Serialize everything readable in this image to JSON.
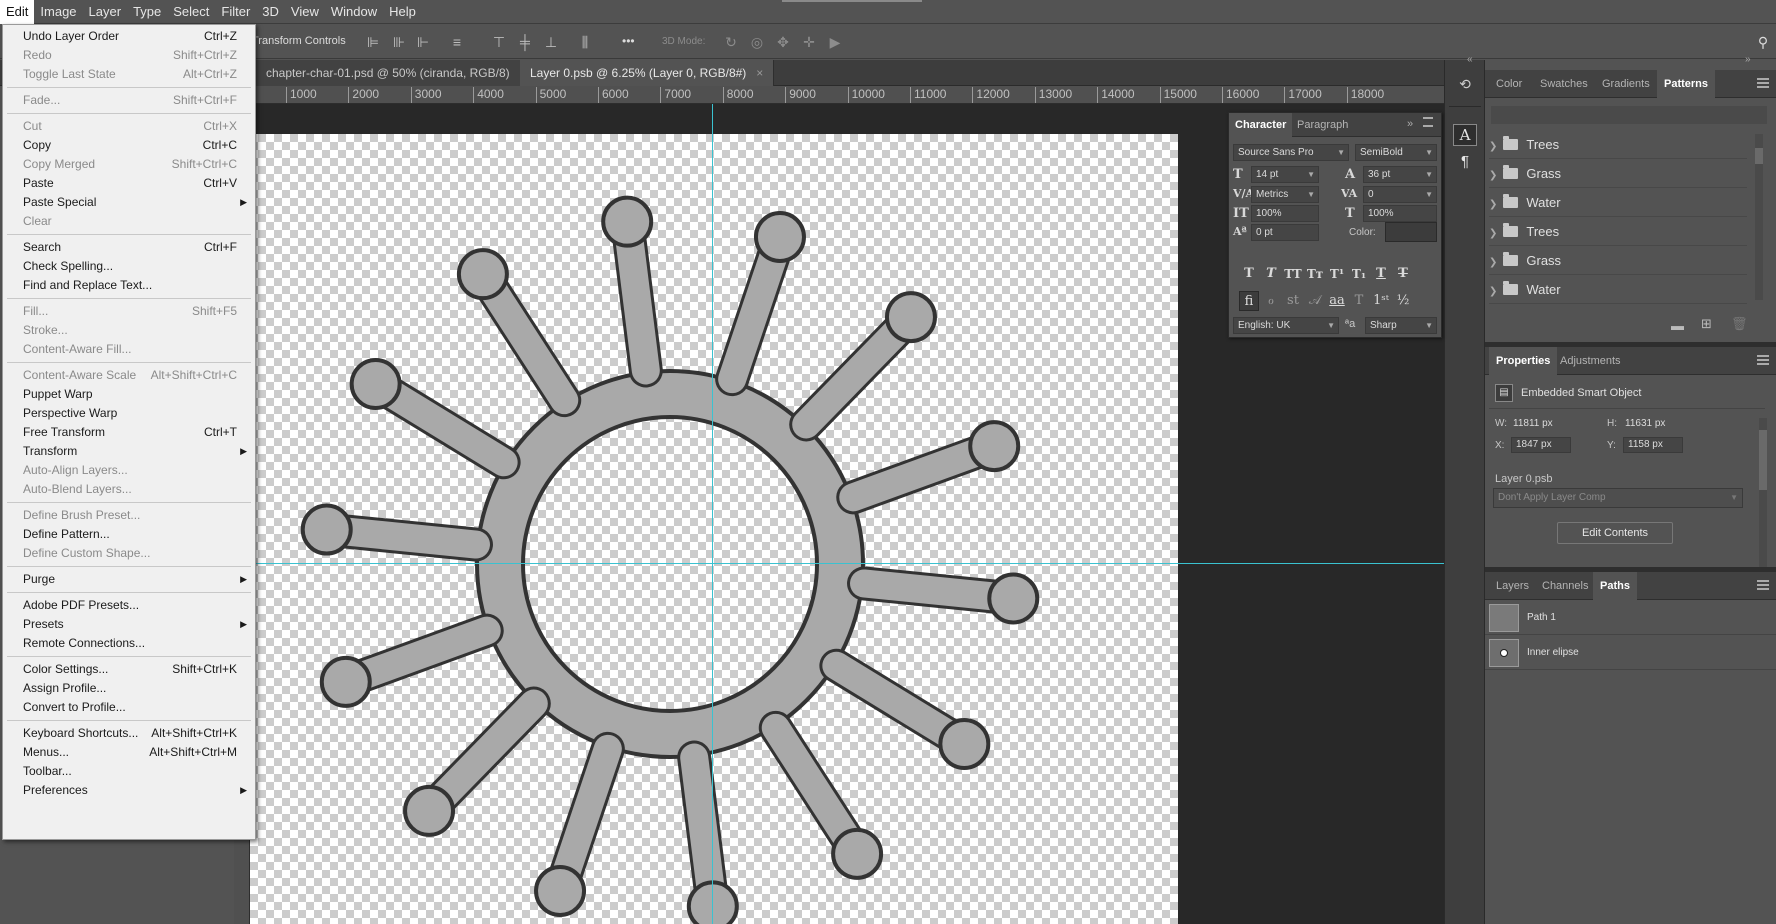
{
  "menubar": {
    "items": [
      "Edit",
      "Image",
      "Layer",
      "Type",
      "Select",
      "Filter",
      "3D",
      "View",
      "Window",
      "Help"
    ]
  },
  "optionsbar": {
    "transform_controls": "Transform Controls",
    "mode_3d": "3D Mode:",
    "more": "•••"
  },
  "tabs": [
    {
      "label": "chapter-char-01.psd @ 50% (ciranda, RGB/8)"
    },
    {
      "label": "Layer 0.psb @ 6.25% (Layer 0, RGB/8#)"
    }
  ],
  "ruler": {
    "labels": [
      "1000",
      "2000",
      "3000",
      "4000",
      "5000",
      "6000",
      "7000",
      "8000",
      "9000",
      "10000",
      "11000",
      "12000",
      "13000",
      "14000",
      "15000",
      "16000",
      "17000",
      "18000"
    ]
  },
  "edit_menu": {
    "items": [
      {
        "label": "Undo Layer Order",
        "shortcut": "Ctrl+Z",
        "disabled": false
      },
      {
        "label": "Redo",
        "shortcut": "Shift+Ctrl+Z",
        "disabled": true
      },
      {
        "label": "Toggle Last State",
        "shortcut": "Alt+Ctrl+Z",
        "disabled": true
      },
      {
        "sep": true
      },
      {
        "label": "Fade...",
        "shortcut": "Shift+Ctrl+F",
        "disabled": true
      },
      {
        "sep": true
      },
      {
        "label": "Cut",
        "shortcut": "Ctrl+X",
        "disabled": true
      },
      {
        "label": "Copy",
        "shortcut": "Ctrl+C",
        "disabled": false
      },
      {
        "label": "Copy Merged",
        "shortcut": "Shift+Ctrl+C",
        "disabled": true
      },
      {
        "label": "Paste",
        "shortcut": "Ctrl+V",
        "disabled": false
      },
      {
        "label": "Paste Special",
        "shortcut": "",
        "disabled": false,
        "sub": true
      },
      {
        "label": "Clear",
        "shortcut": "",
        "disabled": true
      },
      {
        "sep": true
      },
      {
        "label": "Search",
        "shortcut": "Ctrl+F",
        "disabled": false
      },
      {
        "label": "Check Spelling...",
        "shortcut": "",
        "disabled": false
      },
      {
        "label": "Find and Replace Text...",
        "shortcut": "",
        "disabled": false
      },
      {
        "sep": true
      },
      {
        "label": "Fill...",
        "shortcut": "Shift+F5",
        "disabled": true
      },
      {
        "label": "Stroke...",
        "shortcut": "",
        "disabled": true
      },
      {
        "label": "Content-Aware Fill...",
        "shortcut": "",
        "disabled": true
      },
      {
        "sep": true
      },
      {
        "label": "Content-Aware Scale",
        "shortcut": "Alt+Shift+Ctrl+C",
        "disabled": true
      },
      {
        "label": "Puppet Warp",
        "shortcut": "",
        "disabled": false
      },
      {
        "label": "Perspective Warp",
        "shortcut": "",
        "disabled": false
      },
      {
        "label": "Free Transform",
        "shortcut": "Ctrl+T",
        "disabled": false
      },
      {
        "label": "Transform",
        "shortcut": "",
        "disabled": false,
        "sub": true
      },
      {
        "label": "Auto-Align Layers...",
        "shortcut": "",
        "disabled": true
      },
      {
        "label": "Auto-Blend Layers...",
        "shortcut": "",
        "disabled": true
      },
      {
        "sep": true
      },
      {
        "label": "Define Brush Preset...",
        "shortcut": "",
        "disabled": true
      },
      {
        "label": "Define Pattern...",
        "shortcut": "",
        "disabled": false
      },
      {
        "label": "Define Custom Shape...",
        "shortcut": "",
        "disabled": true
      },
      {
        "sep": true
      },
      {
        "label": "Purge",
        "shortcut": "",
        "disabled": false,
        "sub": true
      },
      {
        "sep": true
      },
      {
        "label": "Adobe PDF Presets...",
        "shortcut": "",
        "disabled": false
      },
      {
        "label": "Presets",
        "shortcut": "",
        "disabled": false,
        "sub": true
      },
      {
        "label": "Remote Connections...",
        "shortcut": "",
        "disabled": false
      },
      {
        "sep": true
      },
      {
        "label": "Color Settings...",
        "shortcut": "Shift+Ctrl+K",
        "disabled": false
      },
      {
        "label": "Assign Profile...",
        "shortcut": "",
        "disabled": false
      },
      {
        "label": "Convert to Profile...",
        "shortcut": "",
        "disabled": false
      },
      {
        "sep": true
      },
      {
        "label": "Keyboard Shortcuts...",
        "shortcut": "Alt+Shift+Ctrl+K",
        "disabled": false
      },
      {
        "label": "Menus...",
        "shortcut": "Alt+Shift+Ctrl+M",
        "disabled": false
      },
      {
        "label": "Toolbar...",
        "shortcut": "",
        "disabled": false
      },
      {
        "label": "Preferences",
        "shortcut": "",
        "disabled": false,
        "sub": true
      }
    ]
  },
  "character": {
    "tab_character": "Character",
    "tab_paragraph": "Paragraph",
    "font_family": "Source Sans Pro",
    "font_style": "SemiBold",
    "size": "14 pt",
    "leading": "36 pt",
    "kerning": "Metrics",
    "tracking": "0",
    "vscale": "100%",
    "hscale": "100%",
    "baseline": "0 pt",
    "color_label": "Color:",
    "language": "English: UK",
    "aa_label": "ªa",
    "antialias": "Sharp"
  },
  "patterns_panel": {
    "tabs": [
      "Color",
      "Swatches",
      "Gradients",
      "Patterns"
    ],
    "items": [
      "Trees",
      "Grass",
      "Water",
      "Trees",
      "Grass",
      "Water"
    ]
  },
  "properties": {
    "tabs": [
      "Properties",
      "Adjustments"
    ],
    "type": "Embedded Smart Object",
    "w_label": "W:",
    "w": "11811 px",
    "h_label": "H:",
    "h": "11631 px",
    "x_label": "X:",
    "x": "1847 px",
    "y_label": "Y:",
    "y": "1158 px",
    "file": "Layer 0.psb",
    "comp": "Don't Apply Layer Comp",
    "edit_btn": "Edit Contents"
  },
  "paths_panel": {
    "tabs": [
      "Layers",
      "Channels",
      "Paths"
    ],
    "items": [
      "Path 1",
      "Inner elipse"
    ]
  }
}
